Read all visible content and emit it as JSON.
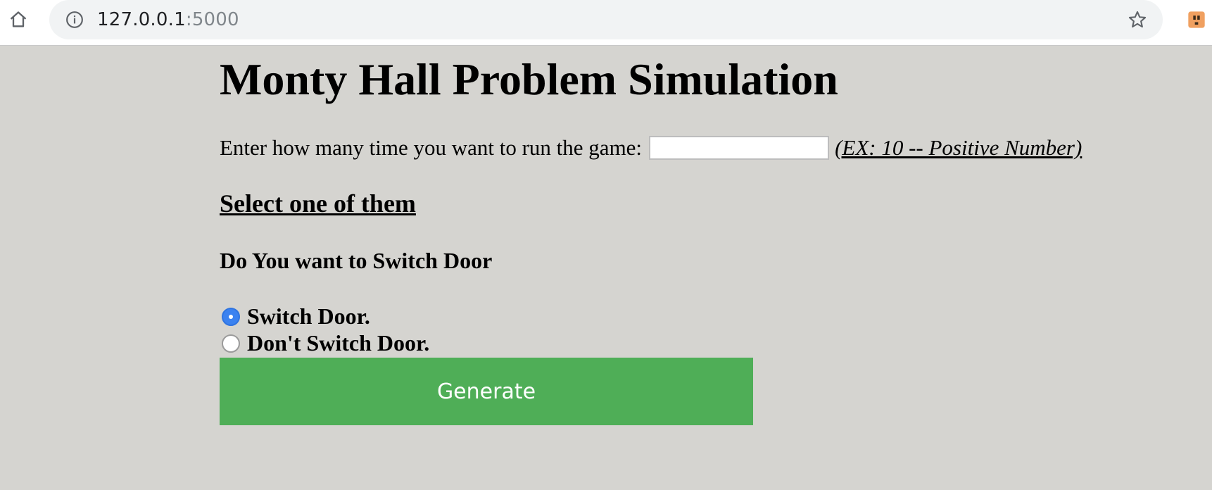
{
  "browser": {
    "url_host": "127.0.0.1",
    "url_port": ":5000"
  },
  "page": {
    "title": "Monty Hall Problem Simulation",
    "run_prompt": "Enter how many time you want to run the game:",
    "run_input_value": "",
    "run_hint": "(EX: 10 -- Positive Number) ",
    "select_heading": "Select one of them",
    "question": "Do You want to Switch Door",
    "options": [
      {
        "label": "Switch Door.",
        "checked": true
      },
      {
        "label": "Don't Switch Door.",
        "checked": false
      }
    ],
    "generate_label": "Generate"
  },
  "colors": {
    "page_background": "#d5d4d0",
    "button_green": "#4fae57",
    "radio_selected_blue": "#3b82f0"
  }
}
